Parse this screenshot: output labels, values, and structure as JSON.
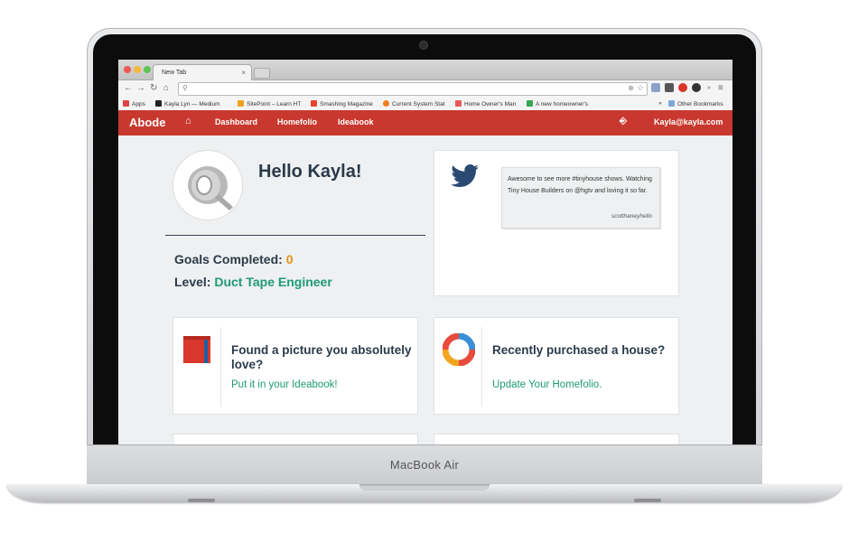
{
  "device": {
    "model": "MacBook Air"
  },
  "browser": {
    "tab_title": "New Tab",
    "bookmarks": [
      {
        "label": "Apps",
        "color": "#d44"
      },
      {
        "label": "Kayla Lyn — Medium",
        "color": "#222"
      },
      {
        "label": "SitePoint – Learn HT",
        "color": "#f1a11e"
      },
      {
        "label": "Smashing Magazine",
        "color": "#e8432c"
      },
      {
        "label": "Current System Stat",
        "color": "#ef7d22"
      },
      {
        "label": "Home Owner's Man",
        "color": "#e95b5b"
      },
      {
        "label": "A new homeowner's",
        "color": "#34a853"
      }
    ],
    "other_bookmarks": "Other Bookmarks",
    "overflow": "»"
  },
  "app": {
    "brand": "Abode",
    "nav": [
      "Dashboard",
      "Homefolio",
      "Ideabook"
    ],
    "user_email": "Kayla@kayla.com"
  },
  "profile": {
    "greeting": "Hello Kayla!",
    "goals_label": "Goals Completed:",
    "goals_value": "0",
    "level_label": "Level:",
    "level_value": "Duct Tape Engineer"
  },
  "tweet": {
    "text": "Awesome to see more #tinyhouse shows. Watching Tiny House Builders on @hgtv and loving it so far.",
    "handle": "scotthaneyhello"
  },
  "cards": [
    {
      "title": "Found a picture you absolutely love?",
      "link": "Put it in your Ideabook!"
    },
    {
      "title": "Recently purchased a house?",
      "link": "Update Your Homefolio."
    }
  ],
  "colors": {
    "nav_red": "#c8382e",
    "accent_green": "#1f9a73",
    "accent_orange": "#e09416",
    "heading": "#2b3a4b",
    "twitter_blue": "#2b4a73"
  },
  "icons": {
    "avatar": "duct-tape-icon",
    "tweet": "twitter-bird-icon",
    "ideabook": "book-icon",
    "homefolio": "lifebuoy-icon"
  }
}
